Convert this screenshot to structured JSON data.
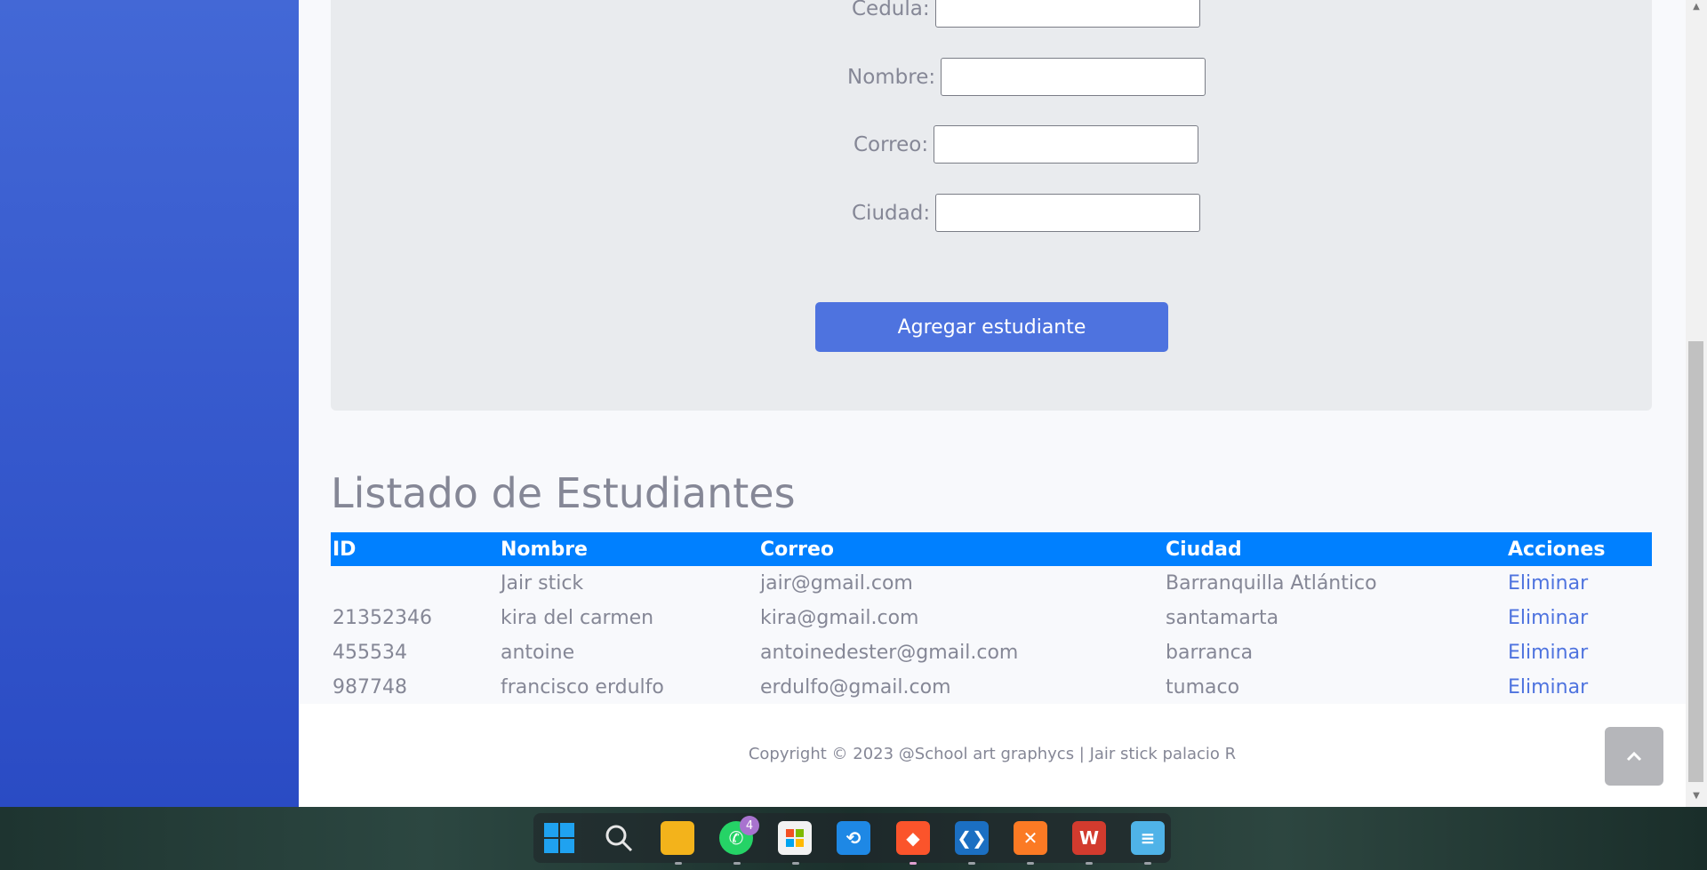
{
  "form": {
    "fields": [
      {
        "label": "Cedula:",
        "value": ""
      },
      {
        "label": "Nombre:",
        "value": ""
      },
      {
        "label": "Correo:",
        "value": ""
      },
      {
        "label": "Ciudad:",
        "value": ""
      }
    ],
    "submit_label": "Agregar estudiante"
  },
  "list": {
    "title": "Listado de Estudiantes",
    "headers": [
      "ID",
      "Nombre",
      "Correo",
      "Ciudad",
      "Acciones"
    ],
    "rows": [
      {
        "id": "",
        "nombre": "Jair stick",
        "correo": "jair@gmail.com",
        "ciudad": "Barranquilla Atlántico",
        "accion": "Eliminar"
      },
      {
        "id": "21352346",
        "nombre": "kira del carmen",
        "correo": "kira@gmail.com",
        "ciudad": "santamarta",
        "accion": "Eliminar"
      },
      {
        "id": "455534",
        "nombre": "antoine",
        "correo": "antoinedester@gmail.com",
        "ciudad": "barranca",
        "accion": "Eliminar"
      },
      {
        "id": "987748",
        "nombre": "francisco erdulfo",
        "correo": "erdulfo@gmail.com",
        "ciudad": "tumaco",
        "accion": "Eliminar"
      }
    ]
  },
  "footer": {
    "copyright": "Copyright © 2023 @School art graphycs | Jair stick palacio R"
  },
  "scroll_top_icon": "chevron-up-icon",
  "taskbar": {
    "whatsapp_badge": "4",
    "icons": [
      "windows-start-icon",
      "search-icon",
      "file-explorer-icon",
      "whatsapp-icon",
      "microsoft-store-icon",
      "app-icon",
      "brave-browser-icon",
      "vscode-icon",
      "xampp-icon",
      "wps-office-icon",
      "notepad-icon"
    ]
  },
  "colors": {
    "sidebar": "#4368d6",
    "primary": "#4e73df",
    "table_header": "#0080ff",
    "text_muted": "#858796"
  }
}
